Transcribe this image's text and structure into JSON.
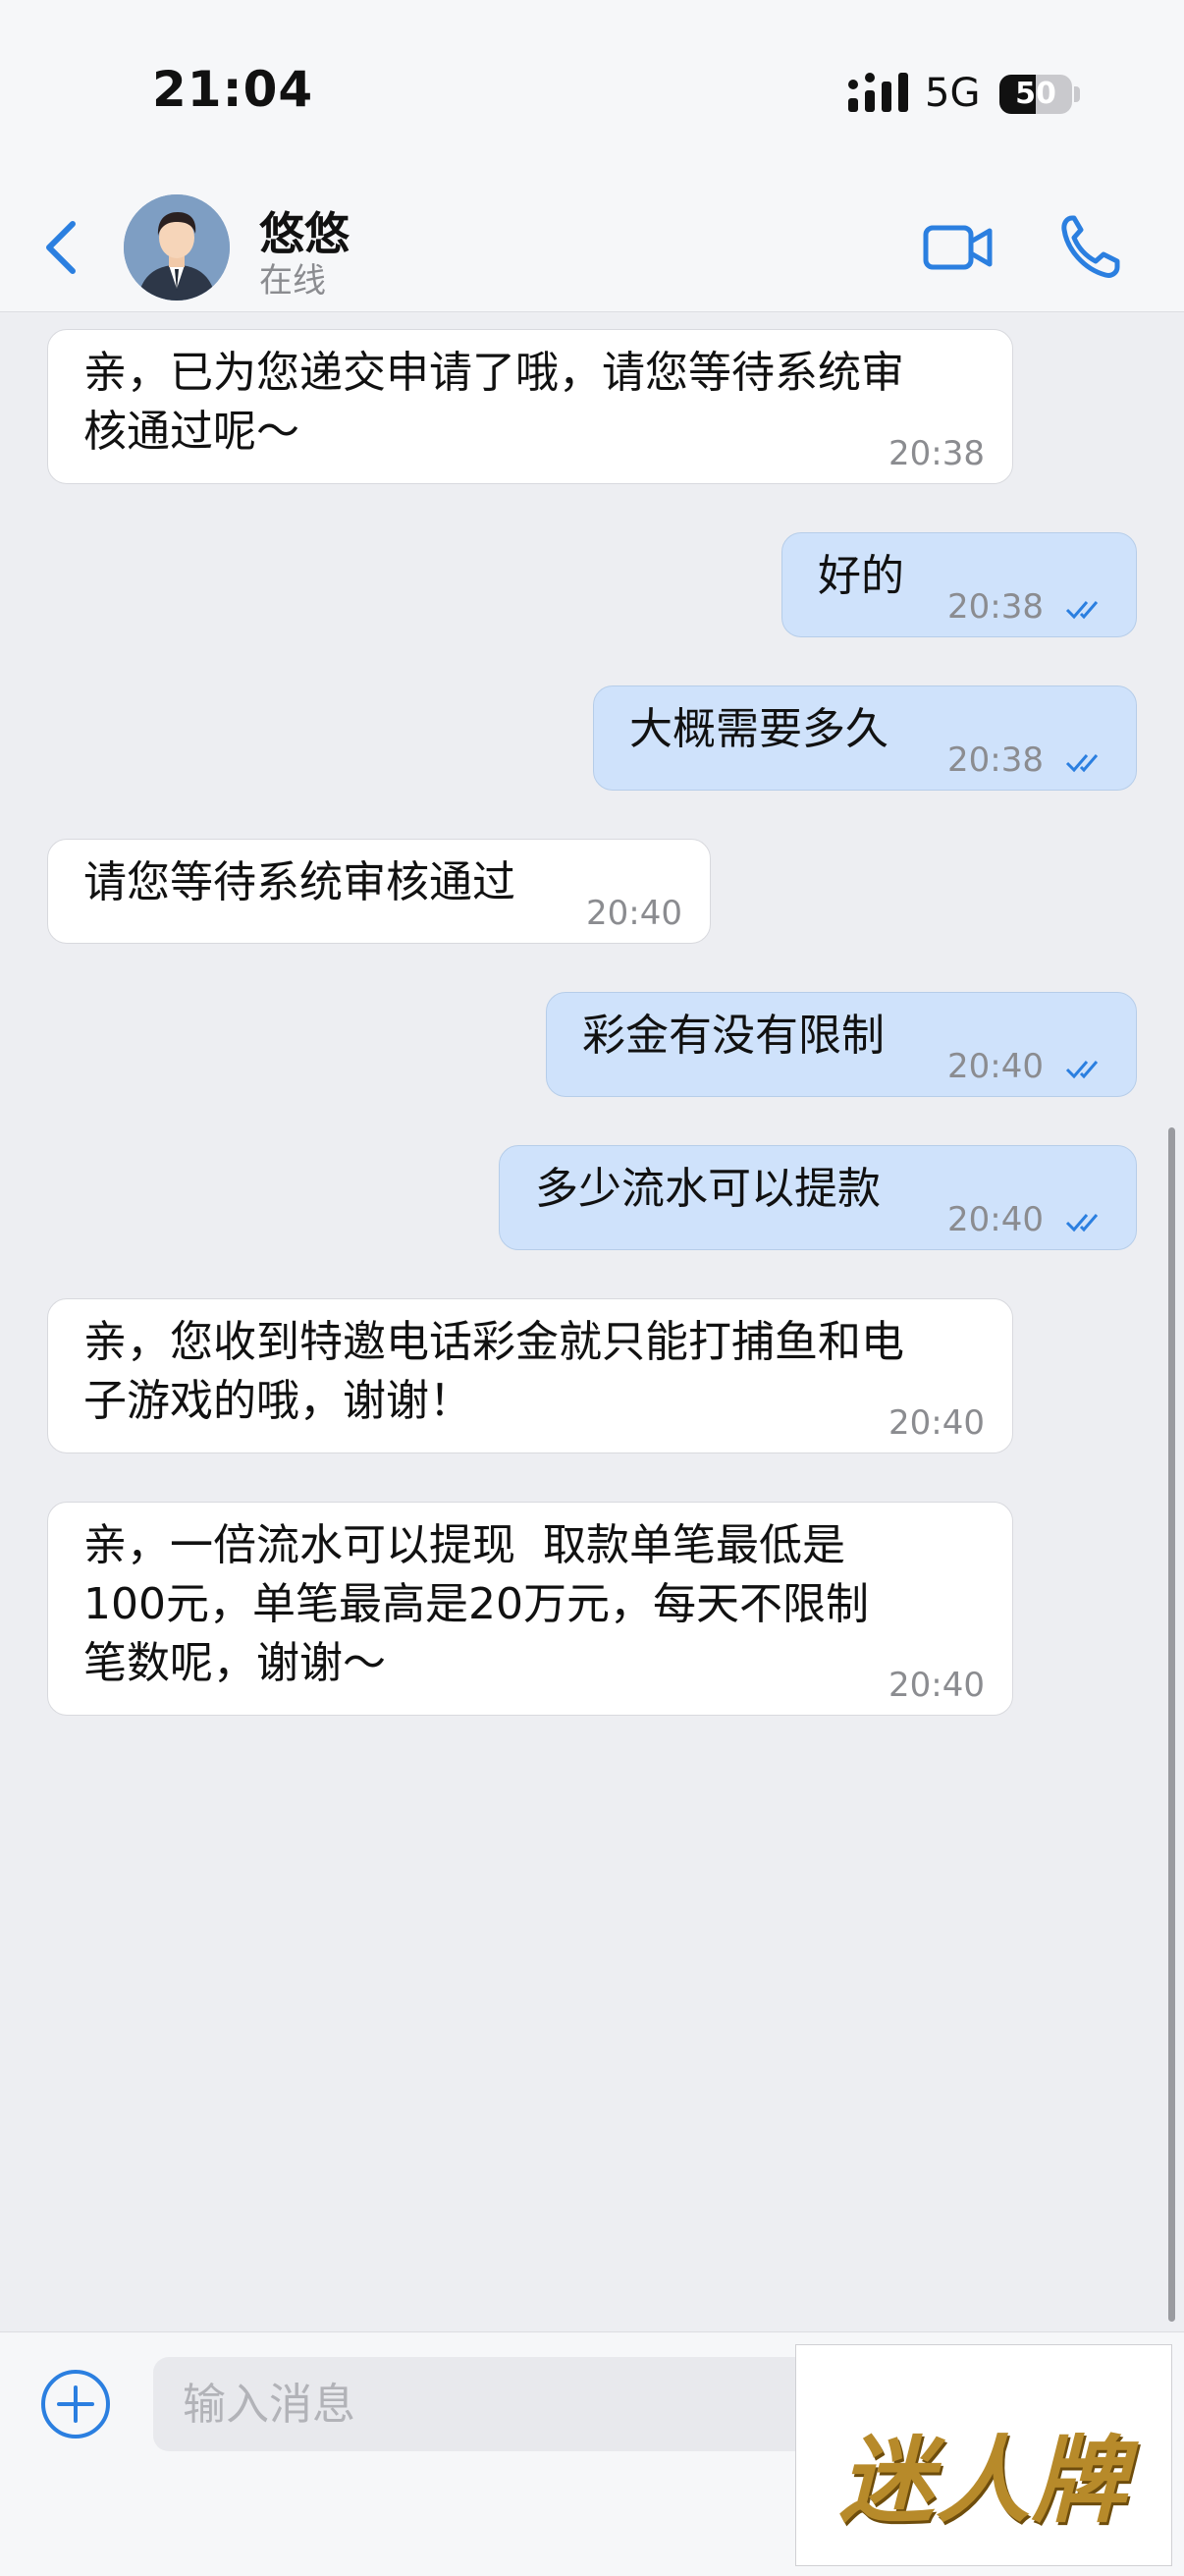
{
  "status_bar": {
    "time": "21:04",
    "network": "5G",
    "battery": "50",
    "battery_level": 0.5
  },
  "header": {
    "name": "悠悠",
    "status": "在线"
  },
  "colors": {
    "accent": "#2b7fe0",
    "outgoing_bubble": "#cfe2fb",
    "incoming_bubble": "#ffffff",
    "background": "#edeef2"
  },
  "messages": [
    {
      "direction": "incoming",
      "text": "亲，已为您递交申请了哦，请您等待系统审\n核通过呢～",
      "time": "20:38"
    },
    {
      "direction": "outgoing",
      "text": "好的",
      "time": "20:38",
      "read": true
    },
    {
      "direction": "outgoing",
      "text": "大概需要多久",
      "time": "20:38",
      "read": true
    },
    {
      "direction": "incoming",
      "text": "请您等待系统审核通过",
      "time": "20:40"
    },
    {
      "direction": "outgoing",
      "text": "彩金有没有限制",
      "time": "20:40",
      "read": true
    },
    {
      "direction": "outgoing",
      "text": "多少流水可以提款",
      "time": "20:40",
      "read": true
    },
    {
      "direction": "incoming",
      "text": "亲，您收到特邀电话彩金就只能打捕鱼和电\n子游戏的哦，谢谢！",
      "time": "20:40"
    },
    {
      "direction": "incoming",
      "text": "亲，一倍流水可以提现  取款单笔最低是\n100元，单笔最高是20万元，每天不限制\n笔数呢，谢谢～",
      "time": "20:40"
    }
  ],
  "input": {
    "placeholder": "输入消息",
    "value": ""
  },
  "watermark": {
    "text": "迷人牌"
  },
  "icons": {
    "back": "chevron-left-icon",
    "video": "video-camera-icon",
    "call": "phone-icon",
    "add": "plus-circle-icon",
    "read": "double-check-icon"
  }
}
